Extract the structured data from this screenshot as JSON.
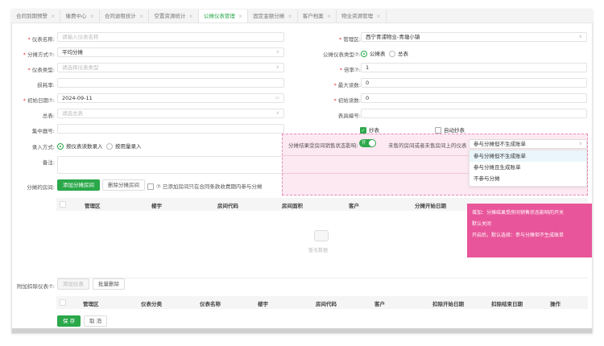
{
  "tabs": [
    {
      "label": "合同到期预警"
    },
    {
      "label": "催费中心"
    },
    {
      "label": "合同退租统计"
    },
    {
      "label": "空置资源统计"
    },
    {
      "label": "公摊仪表管理",
      "active": true
    },
    {
      "label": "固定金额分摊"
    },
    {
      "label": "客户档案"
    },
    {
      "label": "物业资源管理"
    }
  ],
  "form": {
    "meter_name": {
      "label": "仪表名称:",
      "placeholder": "请输入仪表名称"
    },
    "split_method": {
      "label": "分摊方式⑦:",
      "value": "平均分摊"
    },
    "meter_type": {
      "label": "仪表类型:",
      "placeholder": "请选择仪表类型"
    },
    "loss_rate": {
      "label": "损耗率:",
      "value": ""
    },
    "init_date": {
      "label": "初始日期⑦:",
      "value": "2024-09-11"
    },
    "master_meter": {
      "label": "总表:",
      "placeholder": "请选总表"
    },
    "concentrator": {
      "label": "集中器号:",
      "value": ""
    },
    "entry_mode": {
      "label": "录入方式:",
      "options": [
        "按仪表读数录入",
        "按用量录入"
      ],
      "selected": "按仪表读数录入"
    },
    "remark": {
      "label": "备注:",
      "value": ""
    },
    "rooms": {
      "label": "分摊的房间:",
      "add": "添加分摊房间",
      "delete": "删除分摊房间",
      "check_label": "⑦ 已添加房间只在合同条款收费期内参与分摊"
    },
    "area": {
      "label": "管理区:",
      "value": "西宁青浦物业-青塘小镇"
    },
    "public_type": {
      "label": "公摊仪表类型⑦:",
      "options": [
        "公摊表",
        "总表"
      ],
      "selected": "公摊表"
    },
    "multiplier": {
      "label": "倍率⑦:",
      "value": "1"
    },
    "max_reading": {
      "label": "最大读数:",
      "value": "0"
    },
    "init_reading": {
      "label": "初始读数:",
      "value": "0"
    },
    "meter_no": {
      "label": "表具编号:",
      "value": ""
    },
    "read_meter": {
      "label": "抄表",
      "checked": true
    },
    "auto_read": {
      "label": "自动抄表",
      "checked": false
    }
  },
  "pink": {
    "switch_label": "分摊结果受房间销售状态影响:",
    "switch_text": "开",
    "switch_on": true,
    "unsold_label": "未售的房间或者未售房间上的仪表",
    "select_value": "参与分摊但不生成账单",
    "options": [
      "参与分摊但不生成账单",
      "参与分摊且生成账单",
      "不参与分摊"
    ]
  },
  "note": {
    "lines": [
      "增加：分摊结果受房间销售状态影响的开关",
      "默认关闭",
      "开启后，默认选择：参与分摊但不生成账单"
    ],
    "color": "#e8559a"
  },
  "table1": {
    "headers": [
      "管理区",
      "楼宇",
      "房间代码",
      "房间面积",
      "客户",
      "分摊开始日期"
    ],
    "empty": "暂无数据"
  },
  "deduct": {
    "label": "附加扣除仪表⑦:",
    "add": "添加仪表",
    "batch_delete": "批量删除"
  },
  "table2": {
    "headers": [
      "管理区",
      "仪表分类",
      "仪表名称",
      "楼宇",
      "房间代码",
      "客户",
      "扣除开始日期",
      "扣除结束日期",
      "操作"
    ]
  },
  "footer": {
    "save": "保 存",
    "cancel": "取 消"
  },
  "colors": {
    "accent": "#2aa84a",
    "required": "#e4393c"
  }
}
